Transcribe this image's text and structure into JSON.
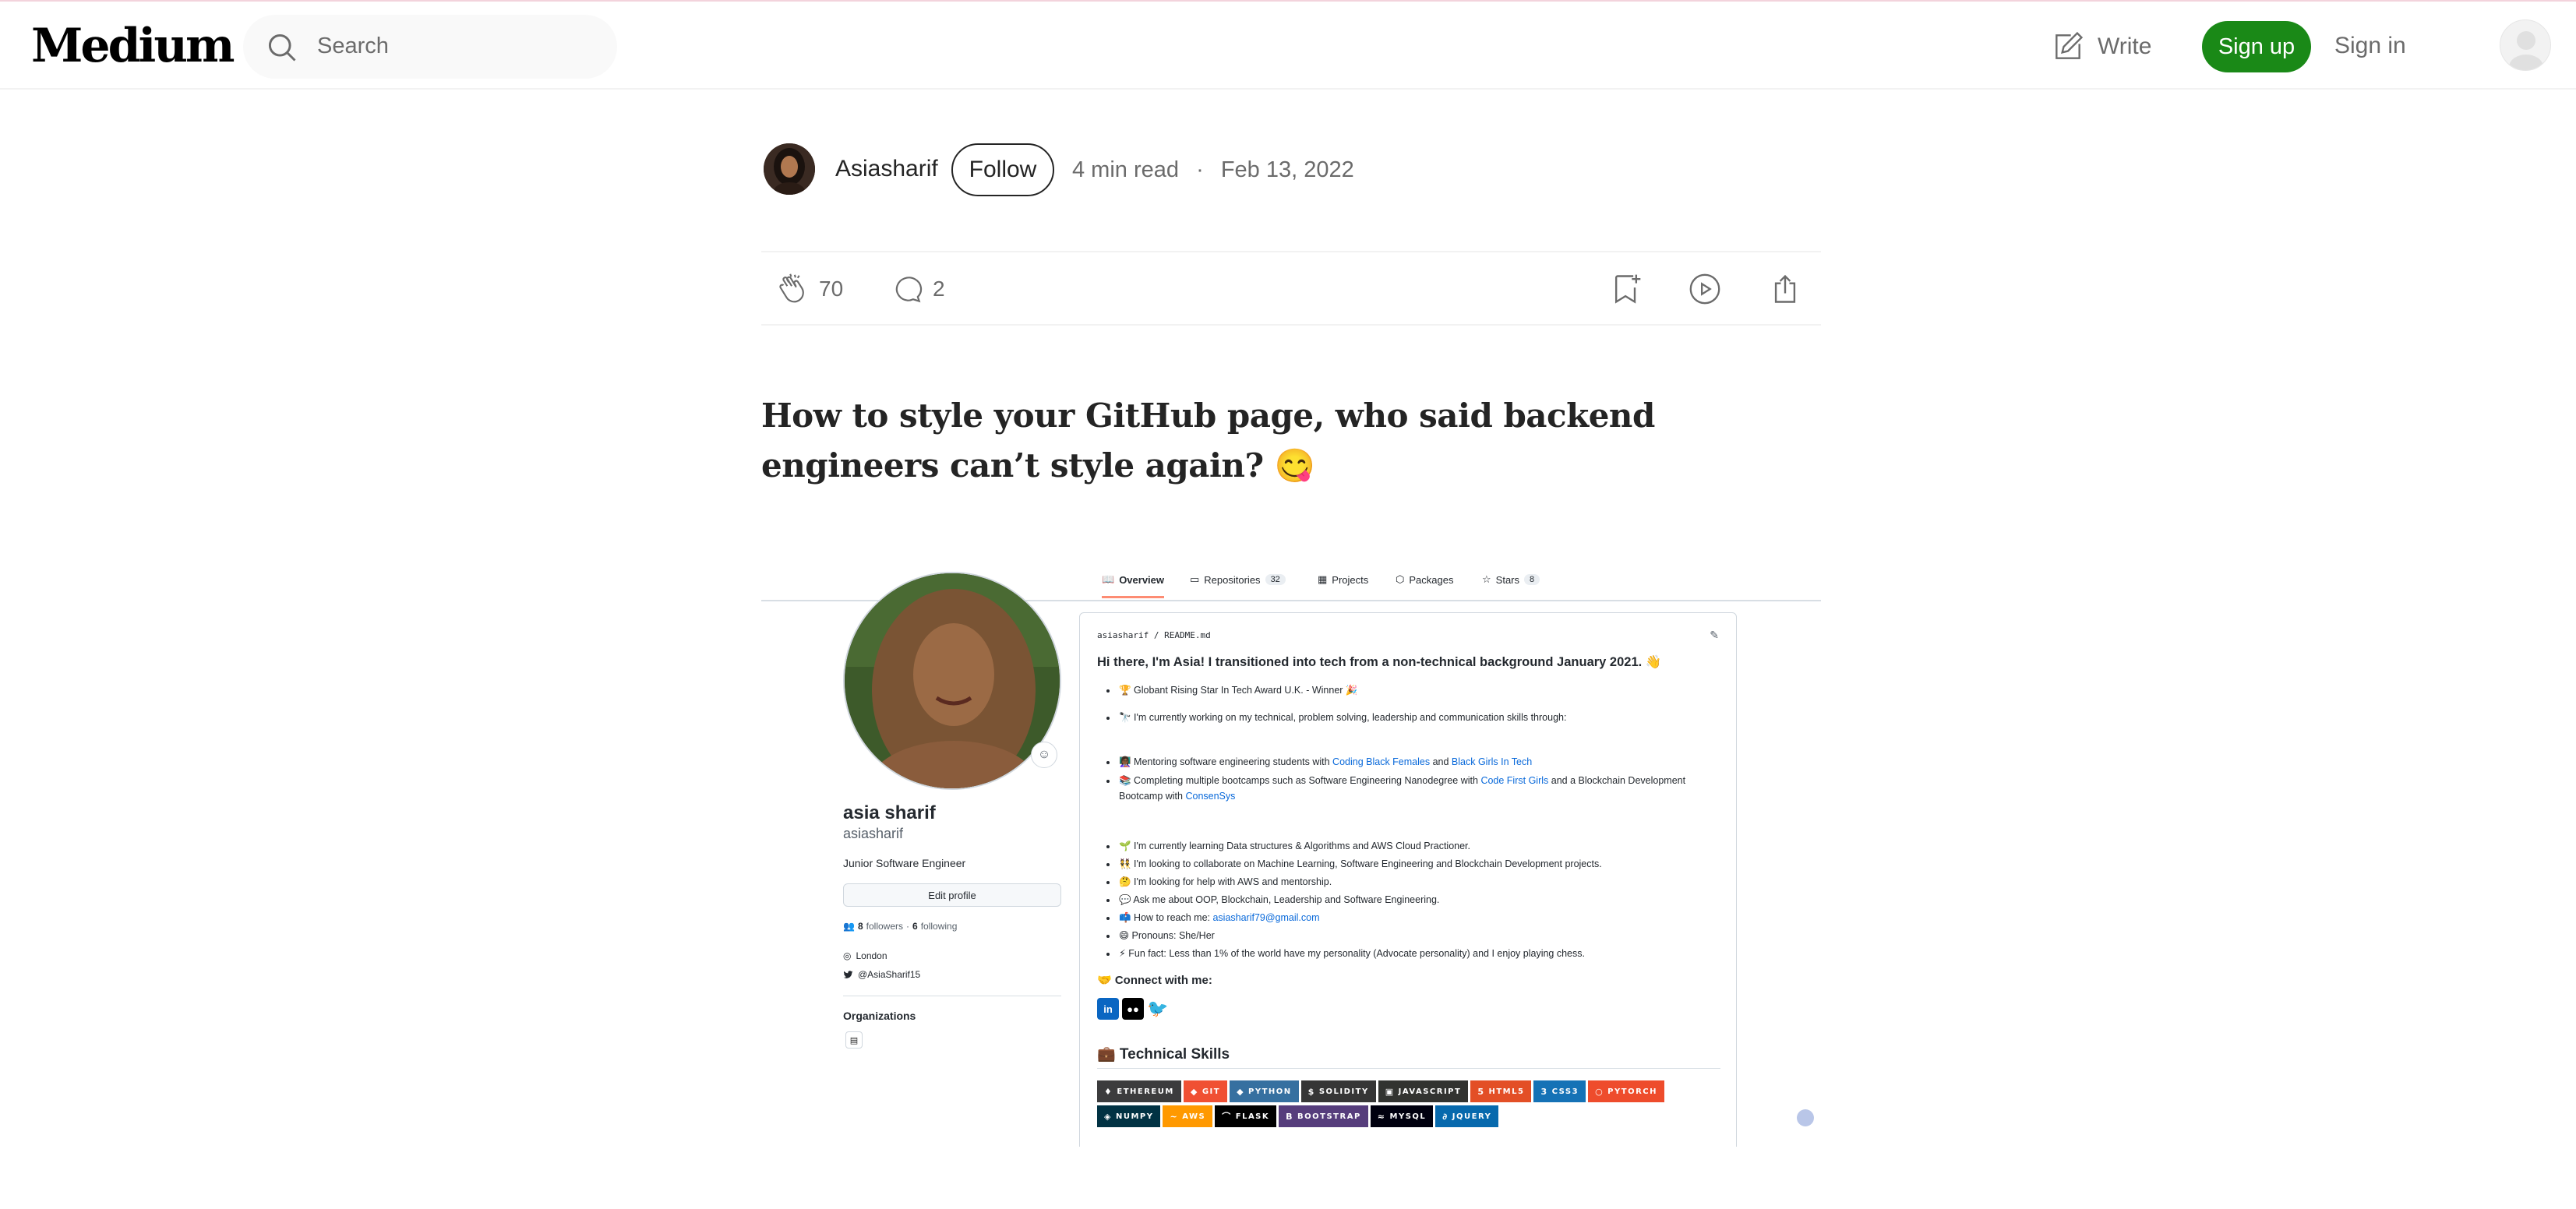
{
  "nav": {
    "logo": "Medium",
    "search_placeholder": "Search",
    "write": "Write",
    "sign_up": "Sign up",
    "sign_in": "Sign in"
  },
  "author": {
    "name": "Asiasharif",
    "follow": "Follow",
    "read_time": "4 min read",
    "separator": "·",
    "date": "Feb 13, 2022"
  },
  "actions": {
    "claps": "70",
    "responses": "2"
  },
  "article": {
    "title": "How to style your GitHub page, who said backend engineers can’t style again? 😋"
  },
  "github": {
    "tabs": [
      {
        "label": "Overview",
        "count": ""
      },
      {
        "label": "Repositories",
        "count": "32"
      },
      {
        "label": "Projects",
        "count": ""
      },
      {
        "label": "Packages",
        "count": ""
      },
      {
        "label": "Stars",
        "count": "8"
      }
    ],
    "profile": {
      "display_name": "asia sharif",
      "username": "asiasharif",
      "bio": "Junior Software Engineer",
      "edit_profile": "Edit profile",
      "followers_count": "8",
      "followers_label": "followers",
      "dot": "·",
      "following_count": "6",
      "following_label": "following",
      "location": "London",
      "twitter": "@AsiaSharif15",
      "organizations": "Organizations"
    },
    "readme": {
      "path": "asiasharif / README.md",
      "heading": "Hi there, I'm Asia! I transitioned into tech from a non-technical background January 2021. 👋",
      "list1": [
        "🏆 Globant Rising Star In Tech Award U.K. - Winner 🎉",
        "🔭 I'm currently working on my technical, problem solving, leadership and communication skills through:"
      ],
      "mentoring": {
        "prefix": "👩🏾‍🏫 Mentoring software engineering students with ",
        "link1": "Coding Black Females",
        "mid": " and ",
        "link2": "Black Girls In Tech"
      },
      "bootcamps": {
        "prefix": "📚 Completing multiple bootcamps such as Software Engineering Nanodegree with ",
        "link1": "Code First Girls",
        "mid": " and a Blockchain Development Bootcamp with ",
        "link2": "ConsenSys"
      },
      "list3": [
        "🌱 I'm currently learning Data structures & Algorithms and AWS Cloud Practioner.",
        "👯 I'm looking to collaborate on Machine Learning, Software Engineering and Blockchain Development projects.",
        "🤔 I'm looking for help with AWS and mentorship.",
        "💬 Ask me about OOP, Blockchain, Leadership and Software Engineering."
      ],
      "reach": {
        "prefix": "📫 How to reach me: ",
        "email": "asiasharif79@gmail.com"
      },
      "list4": [
        "😄 Pronouns: She/Her",
        "⚡ Fun fact: Less than 1% of the world have my personality (Advocate personality) and I enjoy playing chess."
      ],
      "connect": "🤝 Connect with me:",
      "technical_skills": "💼 Technical Skills",
      "badges_row1": [
        {
          "label": "ETHEREUM",
          "color": "#3c3c3d",
          "icon": "♦"
        },
        {
          "label": "GIT",
          "color": "#f05033",
          "icon": "◆"
        },
        {
          "label": "PYTHON",
          "color": "#3670a0",
          "icon": "◆"
        },
        {
          "label": "SOLIDITY",
          "color": "#363636",
          "icon": "$"
        },
        {
          "label": "JAVASCRIPT",
          "color": "#323330",
          "icon": "▣"
        },
        {
          "label": "HTML5",
          "color": "#e34f26",
          "icon": "5"
        },
        {
          "label": "CSS3",
          "color": "#1572b6",
          "icon": "3"
        },
        {
          "label": "PYTORCH",
          "color": "#ee4c2c",
          "icon": "○"
        }
      ],
      "badges_row2": [
        {
          "label": "NUMPY",
          "color": "#013243",
          "icon": "◈"
        },
        {
          "label": "AWS",
          "color": "#ff9900",
          "icon": "~"
        },
        {
          "label": "FLASK",
          "color": "#000000",
          "icon": "⌒"
        },
        {
          "label": "BOOTSTRAP",
          "color": "#563d7c",
          "icon": "B"
        },
        {
          "label": "MYSQL",
          "color": "#00000f",
          "icon": "≈"
        },
        {
          "label": "JQUERY",
          "color": "#0769ad",
          "icon": "∂"
        }
      ]
    }
  },
  "colors": {
    "brand_green": "#1a8917",
    "link_blue": "#0969da",
    "text_primary": "#242424",
    "text_muted": "#6b6b6b"
  }
}
